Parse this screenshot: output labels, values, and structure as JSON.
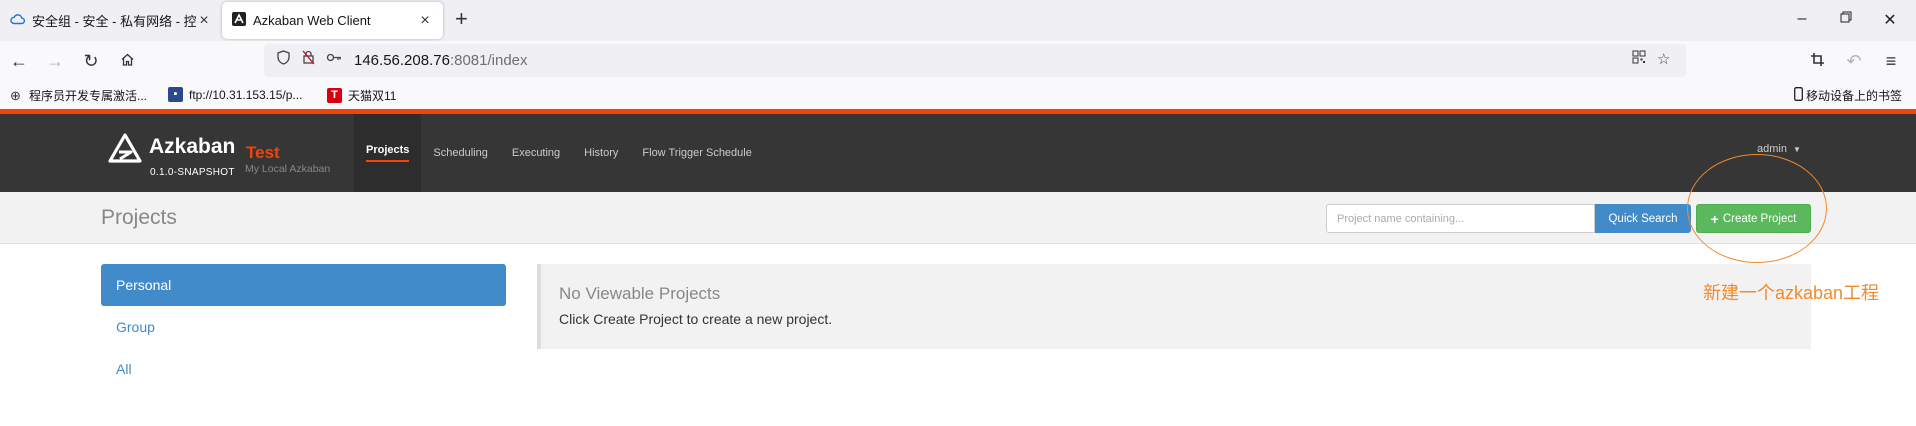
{
  "browser": {
    "tabs": [
      {
        "title": "安全组 - 安全 - 私有网络 - 控制",
        "active": false,
        "icon": "cloud-icon"
      },
      {
        "title": "Azkaban Web Client",
        "active": true,
        "icon": "azkaban-favicon"
      }
    ],
    "url": {
      "host": "146.56.208.76",
      "rest": ":8081/index"
    },
    "bookmarks": [
      {
        "label": "程序员开发专属激活...",
        "icon": "globe-icon"
      },
      {
        "label": "ftp://10.31.153.15/p...",
        "icon": "monitor-icon"
      },
      {
        "label": "天猫双11",
        "icon": "tmall-icon"
      }
    ],
    "mobile_bookmarks": "移动设备上的书签"
  },
  "app": {
    "brand": "Azkaban",
    "env_name": "Test",
    "version": "0.1.0-SNAPSHOT",
    "env_desc": "My Local Azkaban",
    "nav": [
      "Projects",
      "Scheduling",
      "Executing",
      "History",
      "Flow Trigger Schedule"
    ],
    "user": "admin",
    "accent_color": "#f4430b"
  },
  "page": {
    "title": "Projects",
    "search_placeholder": "Project name containing...",
    "quick_search": "Quick Search",
    "create_project": "Create Project"
  },
  "sidebar": [
    "Personal",
    "Group",
    "All"
  ],
  "panel": {
    "heading": "No Viewable Projects",
    "body": "Click Create Project to create a new project."
  },
  "annotation": {
    "text": "新建一个azkaban工程",
    "color": "#f08a2c"
  }
}
